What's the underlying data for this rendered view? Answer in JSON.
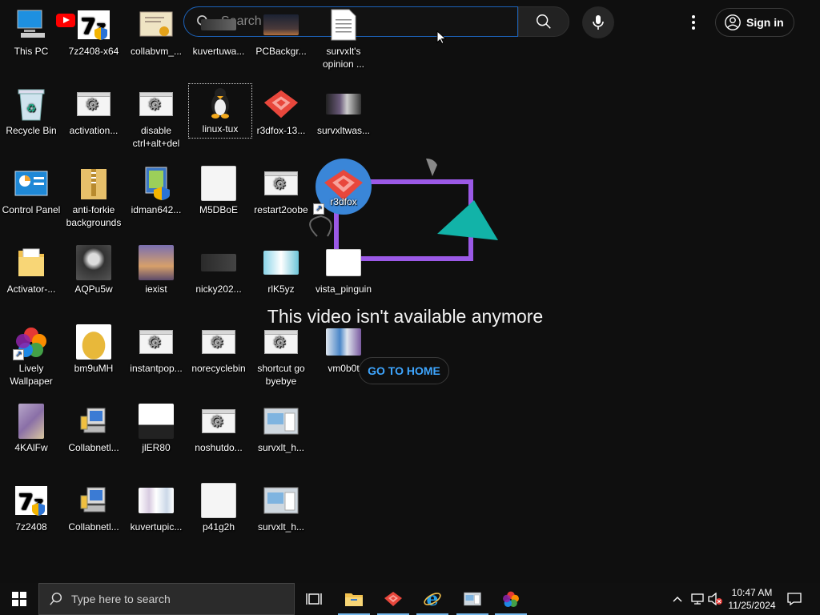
{
  "youtube": {
    "logo_text": "ube",
    "search_placeholder": "Search",
    "sign_in_label": "Sign in",
    "unavailable_message": "This video isn't available anymore",
    "go_home_label": "GO TO HOME",
    "colors": {
      "accent": "#ff0000",
      "link": "#3ea6ff"
    }
  },
  "desktop": {
    "icons": [
      {
        "label": "This PC"
      },
      {
        "label": "7z2408-x64"
      },
      {
        "label": "collabvm_..."
      },
      {
        "label": "kuvertuwa..."
      },
      {
        "label": "PCBackgr..."
      },
      {
        "label": "survxlt's opinion ..."
      },
      {
        "label": "Recycle Bin"
      },
      {
        "label": "activation..."
      },
      {
        "label": "disable ctrl+alt+del"
      },
      {
        "label": "linux-tux"
      },
      {
        "label": "r3dfox-13..."
      },
      {
        "label": "survxltwas..."
      },
      {
        "label": "Control Panel"
      },
      {
        "label": "anti-forkie backgrounds"
      },
      {
        "label": "idman642..."
      },
      {
        "label": "M5DBoE"
      },
      {
        "label": "restart2oobe"
      },
      {
        "label": "r3dfox"
      },
      {
        "label": "Activator-..."
      },
      {
        "label": "AQPu5w"
      },
      {
        "label": "iexist"
      },
      {
        "label": "nicky202..."
      },
      {
        "label": "rlK5yz"
      },
      {
        "label": "vista_pinguin"
      },
      {
        "label": "Lively Wallpaper"
      },
      {
        "label": "bm9uMH"
      },
      {
        "label": "instantpop..."
      },
      {
        "label": "norecyclebin"
      },
      {
        "label": "shortcut go byebye"
      },
      {
        "label": "vm0b0t"
      },
      {
        "label": "4KAlFw"
      },
      {
        "label": "Collabnetl..."
      },
      {
        "label": "jlER80"
      },
      {
        "label": "noshutdo..."
      },
      {
        "label": "survxlt_h..."
      },
      {
        "label": "7z2408"
      },
      {
        "label": "Collabnetl..."
      },
      {
        "label": "kuvertupic..."
      },
      {
        "label": "p41g2h"
      },
      {
        "label": "survxlt_h..."
      }
    ]
  },
  "taskbar": {
    "search_placeholder": "Type here to search",
    "time": "10:47 AM",
    "date": "11/25/2024"
  }
}
